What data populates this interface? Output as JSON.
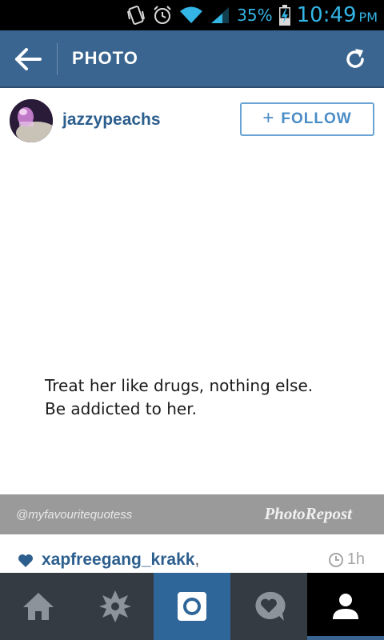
{
  "status_bar": {
    "battery_percent": "35%",
    "time": "10:49",
    "ampm": "PM",
    "icons": [
      "vibrate-icon",
      "alarm-icon",
      "wifi-icon",
      "signal-icon",
      "battery-charging-icon"
    ]
  },
  "action_bar": {
    "title": "PHOTO",
    "back_icon": "back-arrow-icon",
    "refresh_icon": "refresh-icon"
  },
  "post": {
    "username": "jazzypeachs",
    "follow_label": "FOLLOW",
    "follow_plus": "+",
    "quote_line1": "Treat her like drugs, nothing else.",
    "quote_line2": "Be addicted to her.",
    "handle": "@myfavouritequotess",
    "repost_mark": "PhotoRepost"
  },
  "likes": {
    "liker": "xapfreegang_krakk",
    "separator": ",",
    "time_ago": "1h"
  },
  "nav": {
    "tabs": [
      "home",
      "explore",
      "camera",
      "news",
      "profile"
    ],
    "active": "profile"
  },
  "colors": {
    "action_bar": "#3a6590",
    "link_blue": "#2d5f8e",
    "follow_border": "#6aa3d4",
    "status_icon": "#33b5e5",
    "nav_bg": "#343b42",
    "nav_camera": "#2f6699"
  }
}
